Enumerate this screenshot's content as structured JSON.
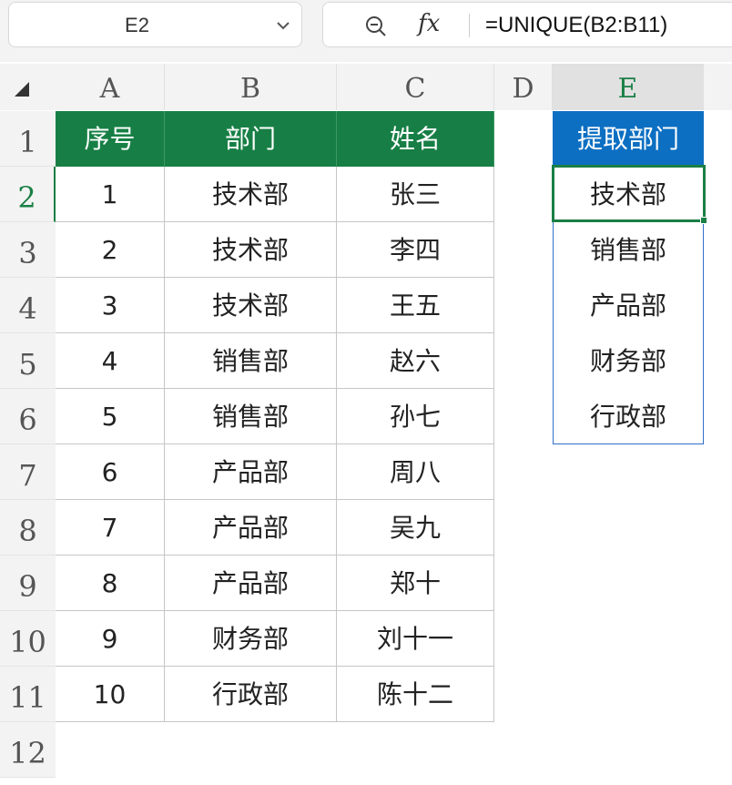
{
  "name_box": {
    "value": "E2"
  },
  "formula_bar": {
    "fx_label": "fx",
    "formula": "=UNIQUE(B2:B11)"
  },
  "columns": [
    "A",
    "B",
    "C",
    "D",
    "E"
  ],
  "rows": [
    "1",
    "2",
    "3",
    "4",
    "5",
    "6",
    "7",
    "8",
    "9",
    "10",
    "11",
    "12"
  ],
  "table": {
    "headers": [
      "序号",
      "部门",
      "姓名"
    ],
    "rows": [
      [
        "1",
        "技术部",
        "张三"
      ],
      [
        "2",
        "技术部",
        "李四"
      ],
      [
        "3",
        "技术部",
        "王五"
      ],
      [
        "4",
        "销售部",
        "赵六"
      ],
      [
        "5",
        "销售部",
        "孙七"
      ],
      [
        "6",
        "产品部",
        "周八"
      ],
      [
        "7",
        "产品部",
        "吴九"
      ],
      [
        "8",
        "产品部",
        "郑十"
      ],
      [
        "9",
        "财务部",
        "刘十一"
      ],
      [
        "10",
        "行政部",
        "陈十二"
      ]
    ]
  },
  "extract": {
    "header": "提取部门",
    "values": [
      "技术部",
      "销售部",
      "产品部",
      "财务部",
      "行政部"
    ]
  },
  "colors": {
    "table_header": "#177f45",
    "extract_header": "#0d6fc2",
    "selection": "#1a7f45"
  }
}
